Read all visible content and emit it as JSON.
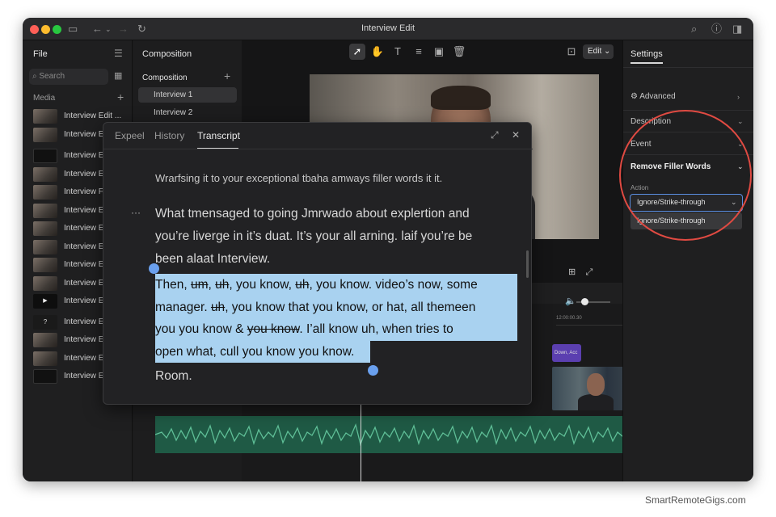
{
  "window": {
    "title": "Interview Edit"
  },
  "left_panel": {
    "title": "File",
    "search_placeholder": "Search",
    "media_label": "Media",
    "items": [
      {
        "label": "Interview Edit ..."
      },
      {
        "label": "Interview E"
      },
      {
        "label": "Interview E"
      },
      {
        "label": "Interview E"
      },
      {
        "label": "Interview F"
      },
      {
        "label": "Interview E"
      },
      {
        "label": "Interview E"
      },
      {
        "label": "Interview E"
      },
      {
        "label": "Interview E"
      },
      {
        "label": "Interview E"
      },
      {
        "label": "Interview E"
      },
      {
        "label": "Interview E"
      },
      {
        "label": "Interview E"
      },
      {
        "label": "Interview E"
      },
      {
        "label": "Interview E"
      }
    ]
  },
  "composition_panel": {
    "header": "Composition",
    "subheader": "Composition",
    "items": [
      "Interview 1",
      "Interview 2"
    ]
  },
  "toolbar": {
    "edit_label": "Edit"
  },
  "timeline": {
    "ruler_label": "12:00:00.30",
    "clip_label": "Down, Acc"
  },
  "transcript_panel": {
    "tabs": [
      "Expeel",
      "History",
      "Transcript"
    ],
    "active_tab": "Transcript",
    "line1": "Wrarfsing it to your exceptional tbaha amways filler words it it.",
    "para1": [
      "What tmensaged to going Jmrwado about explertion and",
      "you’re liverge in it’s duat. It’s your all arning. laif you’re be",
      "been alaat Interview."
    ],
    "highlight": {
      "l1_a": "Then, ",
      "l1_b": "um",
      "l1_c": ", ",
      "l1_d": "uh",
      "l1_e": ", you know, ",
      "l1_f": "uh",
      "l1_g": ", you know. video’s now, some",
      "l2_a": "manager. ",
      "l2_b": "uh",
      "l2_c": ", you know that you know, or hat, all themeen",
      "l3_a": "you you know  & ",
      "l3_b": "you know",
      "l3_c": ". I’all know uh, when tries to",
      "l4": "open what, cull you know you know."
    },
    "last_line": "Room."
  },
  "settings_panel": {
    "tab": "Settings",
    "advanced": "Advanced",
    "description": "Description",
    "event": "Event",
    "section": "Remove Filler Words",
    "action_label": "Action",
    "selected": "Ignore/Strike-through",
    "options": [
      "Ignore/Strike-through"
    ]
  },
  "watermark": "SmartRemoteGigs.com",
  "colors": {
    "accent": "#6aa0ee",
    "highlight": "#a9d2f0",
    "annotation": "#e04a42",
    "audio": "#1f5a45"
  }
}
